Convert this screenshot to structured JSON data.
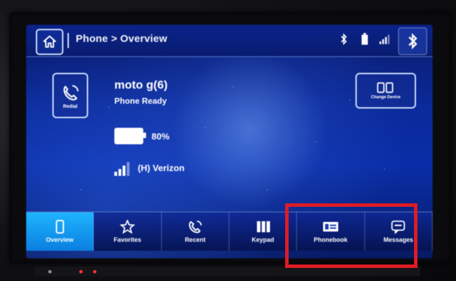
{
  "header": {
    "breadcrumb": "Phone > Overview"
  },
  "redial": {
    "label": "Redial"
  },
  "device": {
    "name": "moto g(6)",
    "status": "Phone Ready",
    "battery": "80%",
    "carrier": "(H) Verizon"
  },
  "change_device": {
    "label": "Change Device"
  },
  "tabs": [
    {
      "label": "Overview",
      "icon": "phone-device-icon",
      "active": true
    },
    {
      "label": "Favorites",
      "icon": "star-icon",
      "active": false
    },
    {
      "label": "Recent",
      "icon": "recent-call-icon",
      "active": false
    },
    {
      "label": "Keypad",
      "icon": "keypad-icon",
      "active": false
    },
    {
      "label": "Phonebook",
      "icon": "phonebook-icon",
      "active": false
    },
    {
      "label": "Messages",
      "icon": "messages-icon",
      "active": false
    }
  ],
  "colors": {
    "highlight": "#e01b24",
    "active_tab": "#1fb4ff",
    "screen_bg": "#0a2ea8"
  },
  "icons": {
    "home": "home-icon",
    "bluetooth": "bluetooth-icon",
    "battery": "battery-icon",
    "signal": "signal-icon"
  }
}
